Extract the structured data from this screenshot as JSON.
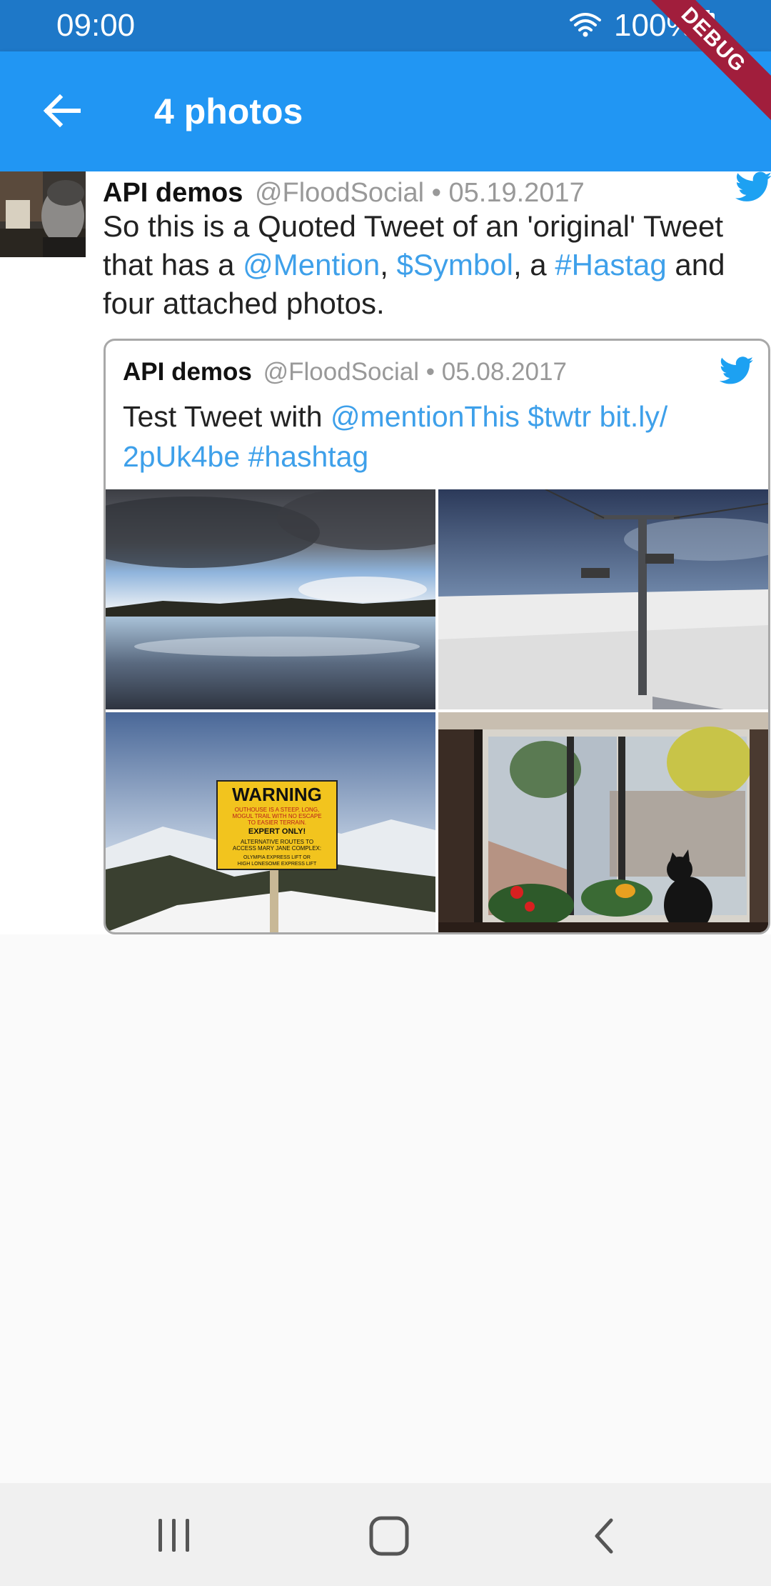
{
  "status_bar": {
    "time": "09:00",
    "battery": "100%",
    "icons": [
      "wifi-icon",
      "battery-icon"
    ]
  },
  "debug_banner": "DEBUG",
  "app_bar": {
    "back_icon": "arrow-back-icon",
    "title": "4 photos"
  },
  "tweet": {
    "user_name": "API demos",
    "handle": "@FloodSocial",
    "date": "• 05.19.2017",
    "text_parts": {
      "p1": "So this is a Quoted Tweet of an 'original' Tweet that has a ",
      "mention": "@Mention",
      "p2": ",  ",
      "symbol": "$Symbol",
      "p3": ", a ",
      "hashtag": "#Hastag",
      "p4": " and four attached photos."
    },
    "colors": {
      "link": "#3ea0ea",
      "twitter_bird": "#1da1f2"
    }
  },
  "quoted_tweet": {
    "user_name": "API demos",
    "handle": "@FloodSocial",
    "date": "• 05.08.2017",
    "text_parts": {
      "p1": "Test Tweet with ",
      "mention": "@mentionThis",
      "p2": " ",
      "symbol": "$twtr",
      "p3": " ",
      "url": "bit.ly/ 2pUk4be",
      "p4": " ",
      "hashtag": "#hashtag"
    },
    "photos": [
      {
        "name": "photo-lake-clouds"
      },
      {
        "name": "photo-ski-lift"
      },
      {
        "name": "photo-warning-sign",
        "sign_title": "WARNING",
        "sign_line1": "OUTHOUSE IS A STEEP, LONG,",
        "sign_line2": "MOGUL TRAIL WITH NO ESCAPE",
        "sign_line3": "TO EASIER TERRAIN.",
        "sign_line4": "EXPERT ONLY!",
        "sign_line5": "ALTERNATIVE ROUTES TO",
        "sign_line6": "ACCESS MARY JANE COMPLEX:",
        "sign_line7": "OLYMPIA EXPRESS LIFT OR",
        "sign_line8": "HIGH LONESOME EXPRESS LIFT"
      },
      {
        "name": "photo-window-cat"
      }
    ]
  },
  "nav_bar": {
    "icons": [
      "recents-icon",
      "home-icon",
      "back-icon"
    ]
  }
}
